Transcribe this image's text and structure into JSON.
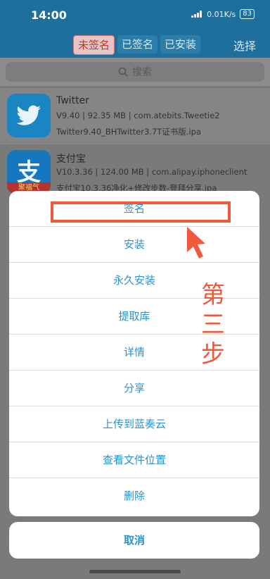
{
  "status": {
    "time": "14:00",
    "network": "0.01K/s",
    "battery": "83"
  },
  "nav": {
    "segments": [
      "未签名",
      "已签名",
      "已安装"
    ],
    "select": "选择"
  },
  "search": {
    "placeholder": "搜索"
  },
  "apps": [
    {
      "name": "Twitter",
      "meta": "V9.40 | 92.35 MB | com.atebits.Tweetie2",
      "file": "Twitter9.40_BHTwitter3.7T证书版.ipa",
      "icon": "twitter-bird-icon"
    },
    {
      "name": "支付宝",
      "meta": "V10.3.36 | 124.00 MB | com.alipay.iphoneclient",
      "file": "支付宝10.3.36净化+修改步数-登拜分享.ipa",
      "icon": "alipay-icon",
      "icon_text": "支",
      "icon_badge": "聚福气"
    }
  ],
  "sheet": {
    "items": [
      "签名",
      "安装",
      "永久安装",
      "提取库",
      "详情",
      "分享",
      "上传到蓝奏云",
      "查看文件位置",
      "删除"
    ],
    "cancel": "取消"
  },
  "annotation": {
    "text": [
      "第",
      "三",
      "步"
    ]
  },
  "colors": {
    "accent": "#2a92d0",
    "nav": "#1f6f9c",
    "annotation": "#ee5a3b"
  }
}
